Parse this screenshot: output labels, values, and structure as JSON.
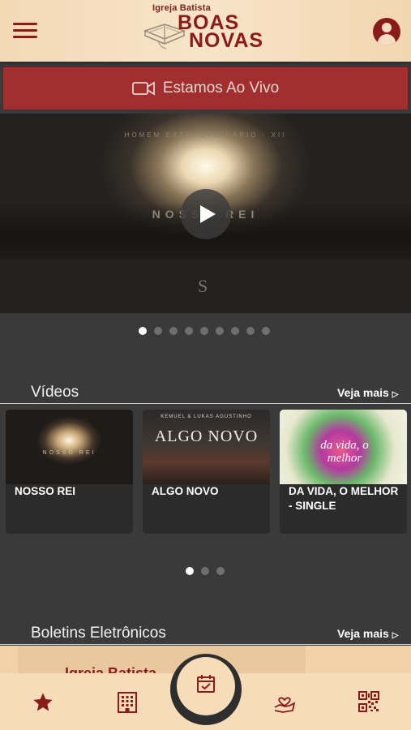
{
  "header": {
    "logo_small": "Igreja Batista",
    "logo_line1": "BOAS",
    "logo_line2": "NOVAS",
    "menu_icon": "hamburger-menu-icon",
    "account_icon": "account-circle-icon"
  },
  "live": {
    "label": "Estamos Ao Vivo",
    "icon": "video-camera-icon"
  },
  "hero": {
    "subtitle": "HOMEM EXTRAORDINÁRIO · XII",
    "title": "NOSSO REI",
    "mark": "S",
    "play_icon": "play-icon",
    "slides_total": 9,
    "active_slide": 1
  },
  "videos": {
    "title": "Vídeos",
    "see_more": "Veja mais",
    "items": [
      {
        "thumb_text": "NOSSO REI",
        "label": "NOSSO REI"
      },
      {
        "thumb_pre": "KEMUEL & LUKAS AGUSTINHO",
        "thumb_text": "ALGO NOVO",
        "label": "ALGO NOVO"
      },
      {
        "thumb_text": "da vida, o melhor",
        "label": "DA VIDA, O MELHOR - SINGLE"
      }
    ],
    "pages_total": 3,
    "active_page": 1
  },
  "bulletins": {
    "title": "Boletins Eletrônicos",
    "see_more": "Veja mais",
    "preview_text": "Igreja Batista"
  },
  "colors": {
    "brand": "#8b1a1a",
    "live_bar": "#a12f2f",
    "header_bg": "#f6dcb8",
    "body_bg": "#3a3a3a"
  },
  "bottom_nav": [
    {
      "name": "favorites",
      "icon": "star-icon"
    },
    {
      "name": "buildings",
      "icon": "building-icon"
    },
    {
      "name": "calendar",
      "icon": "calendar-check-icon"
    },
    {
      "name": "donations",
      "icon": "hand-heart-icon"
    },
    {
      "name": "qr-code",
      "icon": "qr-code-icon"
    }
  ]
}
